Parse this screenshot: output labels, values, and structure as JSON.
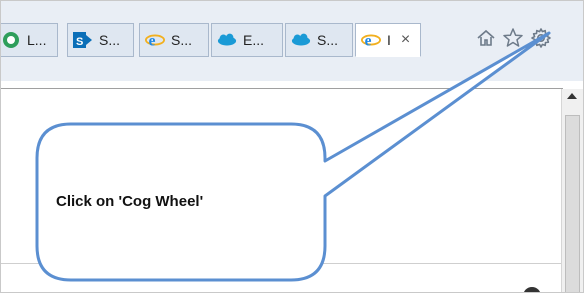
{
  "tabs": [
    {
      "label": "L...",
      "icon": "green-circle-icon",
      "icon_color": "#2e9e5b"
    },
    {
      "label": "S...",
      "icon": "sharepoint-icon",
      "icon_color": "#0b6fb8"
    },
    {
      "label": "S...",
      "icon": "internet-explorer-icon",
      "icon_color": "#1e88e5"
    },
    {
      "label": "E...",
      "icon": "salesforce-cloud-icon",
      "icon_color": "#1a9ad6"
    },
    {
      "label": "S...",
      "icon": "salesforce-cloud-icon",
      "icon_color": "#1a9ad6"
    },
    {
      "label": "I",
      "icon": "internet-explorer-icon",
      "icon_color": "#1e88e5",
      "close": "×"
    }
  ],
  "toolbar": {
    "home_icon": "home-icon",
    "favorites_icon": "star-icon",
    "tools_icon": "cog-wheel-icon"
  },
  "callout": {
    "text": "Click on 'Cog Wheel'",
    "border_color": "#5b8fd1",
    "fill_color": "#ffffff"
  }
}
